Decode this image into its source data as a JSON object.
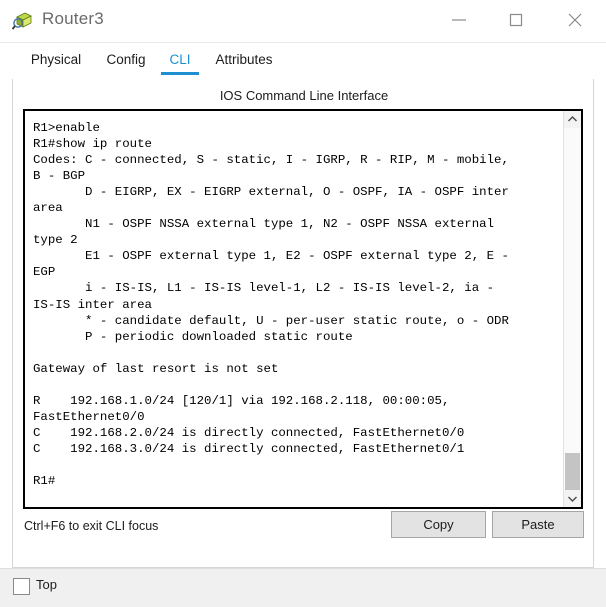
{
  "window": {
    "title": "Router3",
    "icon": "router-device-icon",
    "controls": {
      "minimize": "minimize-icon",
      "maximize": "maximize-icon",
      "close": "close-icon"
    }
  },
  "tabs": [
    {
      "id": "physical",
      "label": "Physical",
      "active": false
    },
    {
      "id": "config",
      "label": "Config",
      "active": false
    },
    {
      "id": "cli",
      "label": "CLI",
      "active": true
    },
    {
      "id": "attributes",
      "label": "Attributes",
      "active": false
    }
  ],
  "panel": {
    "heading": "IOS Command Line Interface",
    "hint": "Ctrl+F6 to exit CLI focus",
    "copy_label": "Copy",
    "paste_label": "Paste"
  },
  "terminal": {
    "text": "R1>enable\nR1#show ip route\nCodes: C - connected, S - static, I - IGRP, R - RIP, M - mobile,\nB - BGP\n       D - EIGRP, EX - EIGRP external, O - OSPF, IA - OSPF inter\narea\n       N1 - OSPF NSSA external type 1, N2 - OSPF NSSA external\ntype 2\n       E1 - OSPF external type 1, E2 - OSPF external type 2, E -\nEGP\n       i - IS-IS, L1 - IS-IS level-1, L2 - IS-IS level-2, ia -\nIS-IS inter area\n       * - candidate default, U - per-user static route, o - ODR\n       P - periodic downloaded static route\n\nGateway of last resort is not set\n\nR    192.168.1.0/24 [120/1] via 192.168.2.118, 00:00:05,\nFastEthernet0/0\nC    192.168.2.0/24 is directly connected, FastEthernet0/0\nC    192.168.3.0/24 is directly connected, FastEthernet0/1\n\nR1#"
  },
  "scrollbar": {
    "up_icon": "chevron-up-icon",
    "down_icon": "chevron-down-icon"
  },
  "bottom": {
    "checkbox_label": "Top",
    "checked": false
  },
  "colors": {
    "accent": "#1e90d2",
    "title_text": "#6b6b6b",
    "terminal_bg": "#ffffff",
    "terminal_fg": "#000000",
    "button_face": "#e3e3e3",
    "scroll_thumb": "#c4c4c4"
  }
}
